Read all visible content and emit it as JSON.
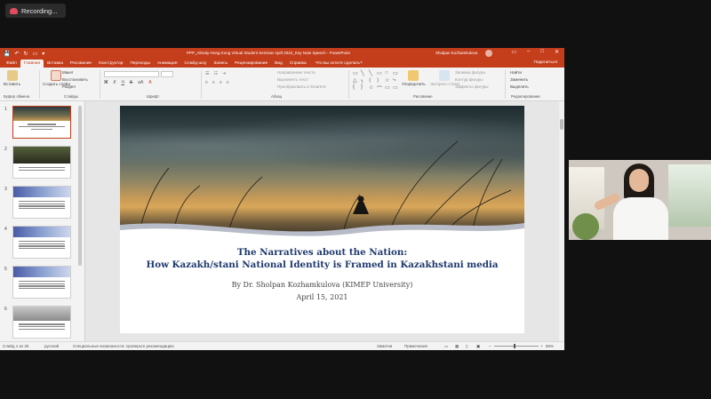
{
  "recording": {
    "label": "Recording..."
  },
  "powerpoint": {
    "title_bar": {
      "doc_title": "PPP_Almaty-Hong Kong Virtual Student Seminar April 2022_Key Note Speech  -  PowerPoint",
      "user_name": "Sholpan Kozhamkulova",
      "qat_save": "💾",
      "qat_undo": "↶",
      "qat_redo": "↻",
      "qat_present": "▭",
      "qat_more": "▾",
      "win_ribbon": "▭",
      "win_min": "–",
      "win_max": "□",
      "win_close": "✕"
    },
    "tabs": [
      "Файл",
      "Главная",
      "Вставка",
      "Рисование",
      "Конструктор",
      "Переходы",
      "Анимация",
      "Слайд-шоу",
      "Запись",
      "Рецензирование",
      "Вид",
      "Справка"
    ],
    "tell_me": "Что вы хотите сделать?",
    "share": "Поделиться",
    "ribbon": {
      "paste": "Вставить",
      "new_slide": "Создать слайд",
      "layout": "Макет",
      "reset": "Восстановить",
      "section": "Раздел",
      "fmt_bold": "Ж",
      "fmt_italic": "К",
      "fmt_underline": "Ч",
      "fmt_strike": "S",
      "fmt_size": "аА",
      "fmt_color": "А",
      "text_direction": "Направление текста",
      "align_text": "Выровнять текст",
      "smartart": "Преобразовать в SmartArt",
      "arrange": "Упорядочить",
      "quick_styles": "Экспресс-стили",
      "shape_fill": "Заливка фигуры",
      "shape_outline": "Контур фигуры",
      "shape_effects": "Эффекты фигуры",
      "find": "Найти",
      "replace": "Заменить",
      "select": "Выделить",
      "groups": {
        "clipboard": "Буфер обмена",
        "slides": "Слайды",
        "font": "Шрифт",
        "paragraph": "Абзац",
        "drawing": "Рисование",
        "editing": "Редактирование"
      },
      "shapes": [
        "▭",
        "╲",
        "╲",
        "▭",
        "○",
        "▭",
        "△",
        "╮",
        "⟨",
        "⟩",
        "☆",
        "⤷",
        "{",
        "}",
        "☆",
        "⌒",
        "▭",
        "▭"
      ]
    },
    "thumbnails": [
      {
        "num": "1"
      },
      {
        "num": "2"
      },
      {
        "num": "3"
      },
      {
        "num": "4"
      },
      {
        "num": "5"
      },
      {
        "num": "6"
      }
    ],
    "slide": {
      "title_line1": "The Narratives about the Nation:",
      "title_line2": "How Kazakh/stani National Identity is Framed in Kazakhstani media",
      "author": "By Dr. Sholpan Kozhamkulova (KIMEP University)",
      "date": "April 15, 2021"
    },
    "status": {
      "slide_info": "Слайд 1 из 25",
      "language": "русский",
      "accessibility": "Специальные возможности: проверьте рекомендацию",
      "notes": "Заметки",
      "comments": "Примечания",
      "zoom": "86%",
      "zoom_minus": "–",
      "zoom_plus": "+"
    }
  },
  "webcam": {
    "label": "presenter video"
  }
}
